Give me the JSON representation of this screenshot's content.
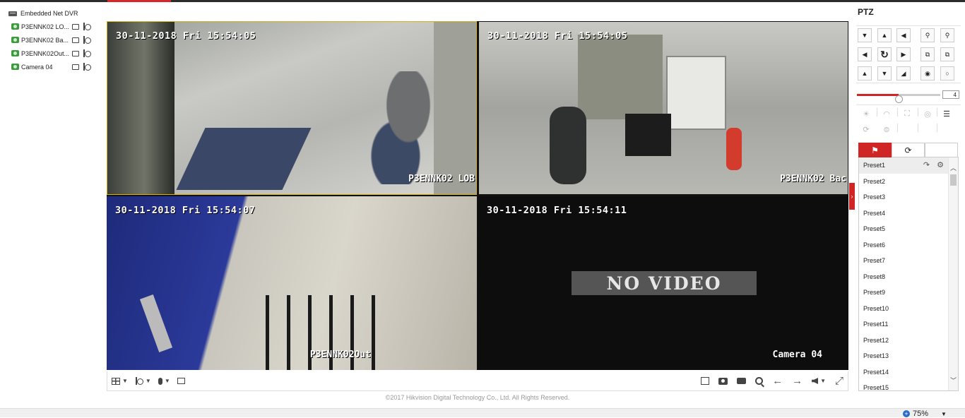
{
  "tree": {
    "root_label": "Embedded Net DVR",
    "cameras": [
      {
        "label": "P3ENNK02 LO..."
      },
      {
        "label": "P3ENNK02 Ba..."
      },
      {
        "label": "P3ENNK02Out..."
      },
      {
        "label": "Camera 04"
      }
    ]
  },
  "grid": {
    "tiles": [
      {
        "timestamp": "30-11-2018 Fri 15:54:05",
        "name": "P3ENNK02 LOB",
        "selected": true
      },
      {
        "timestamp": "30-11-2018 Fri 15:54:05",
        "name": "P3ENNK02 Bac"
      },
      {
        "timestamp": "30-11-2018 Fri 15:54:07",
        "name": "P3ENNK02Out"
      },
      {
        "timestamp": "30-11-2018 Fri 15:54:11",
        "name": "Camera 04",
        "overlay": "NO VIDEO"
      }
    ]
  },
  "toolbar": {
    "left_icons": [
      "window-layout-icon",
      "ptz-control-icon",
      "microphone-icon",
      "stream-icon"
    ],
    "right_icons": [
      "close-all-icon",
      "capture-icon",
      "record-icon",
      "digital-zoom-icon",
      "prev-page-icon",
      "next-page-icon",
      "volume-icon",
      "fullscreen-icon"
    ]
  },
  "footer": {
    "copyright": "©2017 Hikvision Digital Technology Co., Ltd. All Rights Reserved.",
    "zoom_level": "75%"
  },
  "ptz": {
    "title": "PTZ",
    "pad": {
      "up_left": "▼",
      "up": "▲",
      "up_right": "◀",
      "left": "◀",
      "auto": "↻",
      "right": "▶",
      "down_left": "▲",
      "down": "▼",
      "down_right": "◢"
    },
    "speed": {
      "value": "4",
      "level": 0.5
    },
    "tabs": [
      "preset-tab",
      "patrol-tab",
      "pattern-tab"
    ],
    "presets": [
      "Preset1",
      "Preset2",
      "Preset3",
      "Preset4",
      "Preset5",
      "Preset6",
      "Preset7",
      "Preset8",
      "Preset9",
      "Preset10",
      "Preset11",
      "Preset12",
      "Preset13",
      "Preset14",
      "Preset15"
    ]
  },
  "colors": {
    "accent": "#d02525",
    "selected_border": "#d8b11f"
  }
}
